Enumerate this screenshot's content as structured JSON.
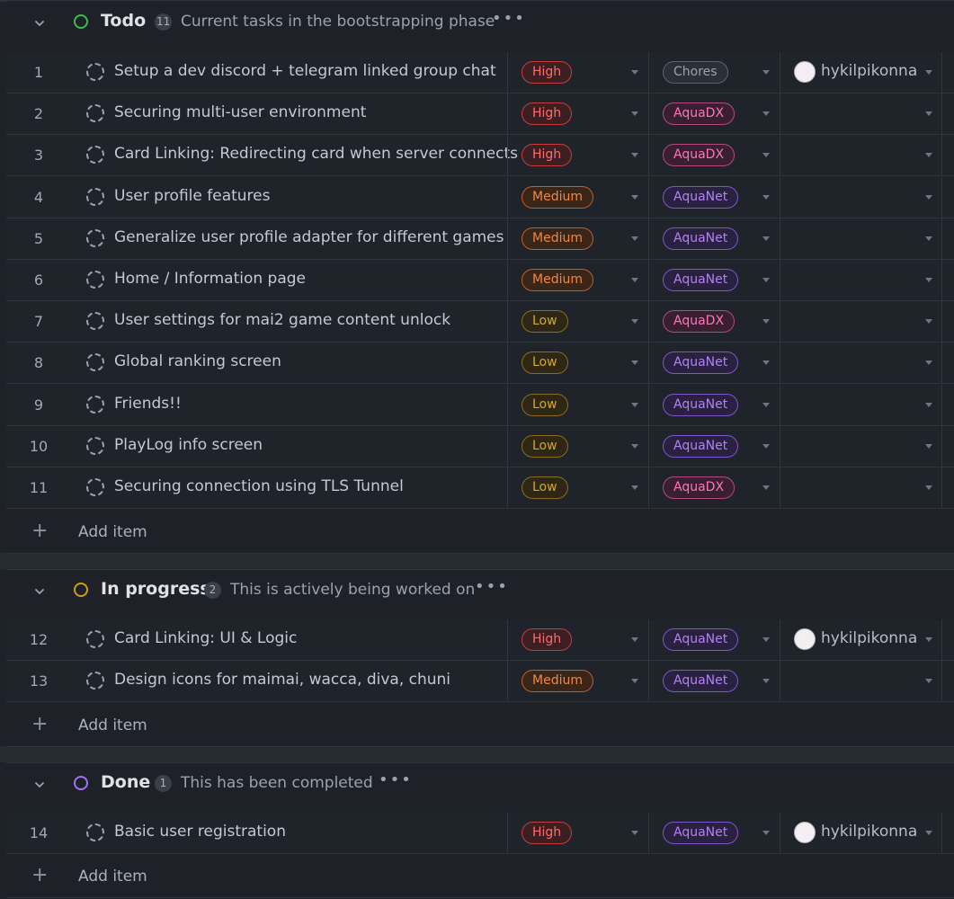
{
  "groups": [
    {
      "title": "Todo",
      "count": "11",
      "description": "Current tasks in the bootstrapping phase",
      "status_color": "#3fb950",
      "add_label": "Add item",
      "rows": [
        {
          "num": "1",
          "title": "Setup a dev discord + telegram linked group chat",
          "priority": "High",
          "label": "Chores",
          "assignee": "hykilpikonna"
        },
        {
          "num": "2",
          "title": "Securing multi-user environment",
          "priority": "High",
          "label": "AquaDX",
          "assignee": ""
        },
        {
          "num": "3",
          "title": "Card Linking: Redirecting card when server connects",
          "priority": "High",
          "label": "AquaDX",
          "assignee": ""
        },
        {
          "num": "4",
          "title": "User profile features",
          "priority": "Medium",
          "label": "AquaNet",
          "assignee": ""
        },
        {
          "num": "5",
          "title": "Generalize user profile adapter for different games",
          "priority": "Medium",
          "label": "AquaNet",
          "assignee": ""
        },
        {
          "num": "6",
          "title": "Home / Information page",
          "priority": "Medium",
          "label": "AquaNet",
          "assignee": ""
        },
        {
          "num": "7",
          "title": "User settings for mai2 game content unlock",
          "priority": "Low",
          "label": "AquaDX",
          "assignee": ""
        },
        {
          "num": "8",
          "title": "Global ranking screen",
          "priority": "Low",
          "label": "AquaNet",
          "assignee": ""
        },
        {
          "num": "9",
          "title": "Friends!!",
          "priority": "Low",
          "label": "AquaNet",
          "assignee": ""
        },
        {
          "num": "10",
          "title": "PlayLog info screen",
          "priority": "Low",
          "label": "AquaNet",
          "assignee": ""
        },
        {
          "num": "11",
          "title": "Securing connection using TLS Tunnel",
          "priority": "Low",
          "label": "AquaDX",
          "assignee": ""
        }
      ]
    },
    {
      "title": "In progress",
      "count": "2",
      "description": "This is actively being worked on",
      "status_color": "#d29922",
      "add_label": "Add item",
      "rows": [
        {
          "num": "12",
          "title": "Card Linking: UI & Logic",
          "priority": "High",
          "label": "AquaNet",
          "assignee": "hykilpikonna"
        },
        {
          "num": "13",
          "title": "Design icons for maimai, wacca, diva, chuni",
          "priority": "Medium",
          "label": "AquaNet",
          "assignee": ""
        }
      ]
    },
    {
      "title": "Done",
      "count": "1",
      "description": "This has been completed",
      "status_color": "#a371f7",
      "add_label": "Add item",
      "rows": [
        {
          "num": "14",
          "title": "Basic user registration",
          "priority": "High",
          "label": "AquaNet",
          "assignee": "hykilpikonna"
        }
      ]
    }
  ],
  "colors": {
    "High": {
      "fg": "#ff6b6b",
      "border": "#c93c3c",
      "bg": "#3b1f22"
    },
    "Medium": {
      "fg": "#f0883e",
      "border": "#b9612a",
      "bg": "#3a2519"
    },
    "Low": {
      "fg": "#d4a72c",
      "border": "#8a6d1e",
      "bg": "#2e2716"
    },
    "Chores": {
      "fg": "#9aa3ad",
      "border": "#5b636d",
      "bg": "#2b3038"
    },
    "AquaDX": {
      "fg": "#f778ba",
      "border": "#b34a82",
      "bg": "#3a1f31"
    },
    "AquaNet": {
      "fg": "#b083f0",
      "border": "#7d56c9",
      "bg": "#2a2140"
    }
  },
  "icons": {
    "group_toggle": "chevron-down-icon",
    "more": "kebab-horizontal-icon",
    "add": "plus-icon",
    "task_status": "dashed-circle-icon",
    "field_menu": "triangle-down-icon"
  }
}
